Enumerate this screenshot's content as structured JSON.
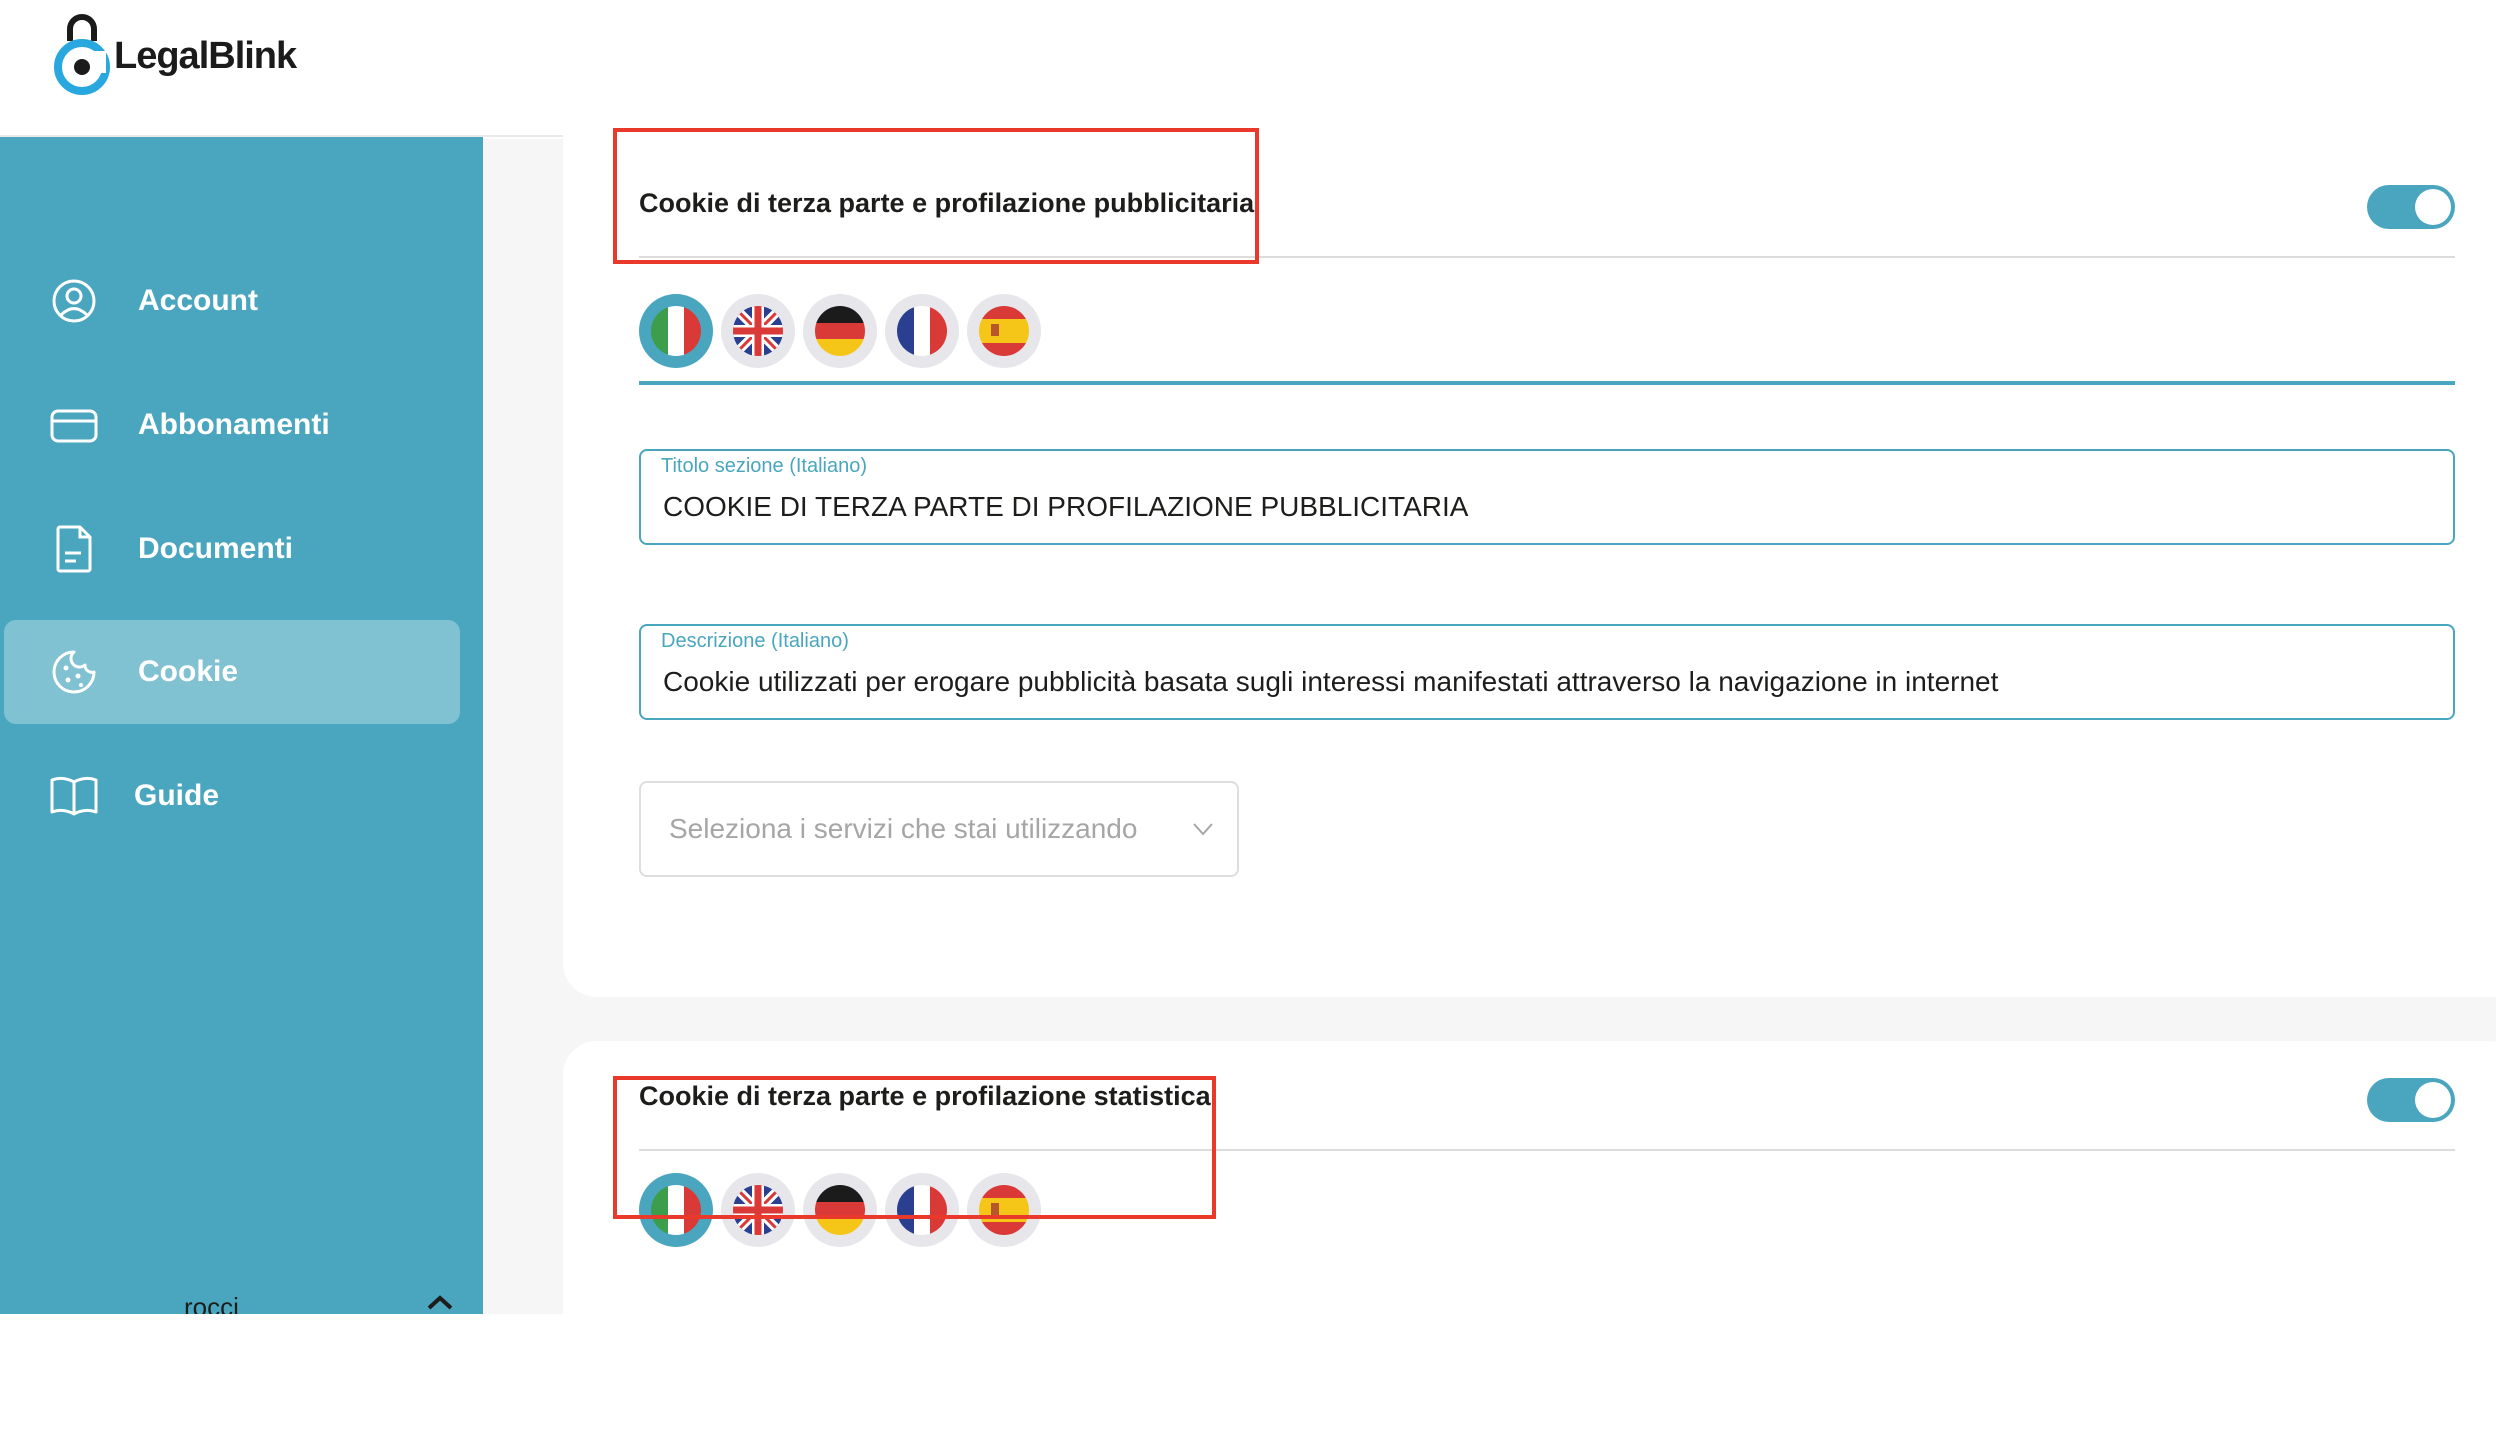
{
  "app": {
    "logo_text": "LegalBlink"
  },
  "sidebar": {
    "items": [
      {
        "label": "Account",
        "icon": "user-circle-icon",
        "active": false
      },
      {
        "label": "Abbonamenti",
        "icon": "credit-card-icon",
        "active": false
      },
      {
        "label": "Documenti",
        "icon": "document-icon",
        "active": false
      },
      {
        "label": "Cookie",
        "icon": "cookie-icon",
        "active": true
      },
      {
        "label": "Guide",
        "icon": "book-icon",
        "active": false
      }
    ],
    "user": {
      "name": "rocci",
      "icon": "chevron-up-icon"
    }
  },
  "sections": [
    {
      "title": "Cookie di terza parte e profilazione pubblicitaria",
      "enabled": true,
      "languages": [
        "italian-flag-icon",
        "uk-flag-icon",
        "german-flag-icon",
        "french-flag-icon",
        "spanish-flag-icon"
      ],
      "active_language": "italian-flag-icon",
      "title_field": {
        "label": "Titolo sezione (Italiano)",
        "value": "COOKIE DI TERZA PARTE DI PROFILAZIONE PUBBLICITARIA"
      },
      "description_field": {
        "label": "Descrizione (Italiano)",
        "value": "Cookie utilizzati per erogare pubblicità basata sugli interessi manifestati attraverso la navigazione in internet"
      },
      "services_select": {
        "placeholder": "Seleziona i servizi che stai utilizzando"
      }
    },
    {
      "title": "Cookie di terza parte e profilazione statistica",
      "enabled": true,
      "languages": [
        "italian-flag-icon",
        "uk-flag-icon",
        "german-flag-icon",
        "french-flag-icon",
        "spanish-flag-icon"
      ],
      "active_language": "italian-flag-icon"
    }
  ],
  "colors": {
    "accent": "#4aa6bf",
    "annotation": "#e8392a",
    "sidebar_bg": "#4aa6bf",
    "main_bg": "#f6f6f6"
  }
}
